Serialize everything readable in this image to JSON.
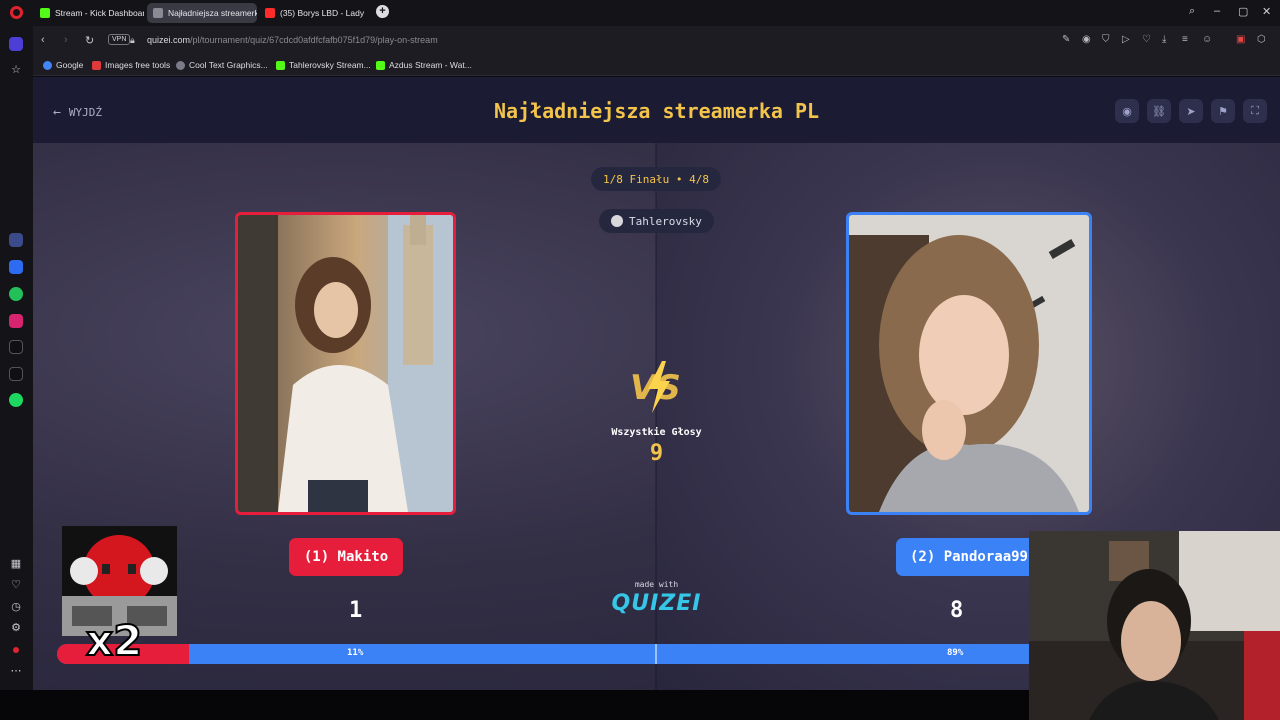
{
  "browser": {
    "tabs": [
      {
        "label": "Stream - Kick Dashboard",
        "color": "#53fc18"
      },
      {
        "label": "Najładniejsza streamerka",
        "color": "#8a8a94"
      },
      {
        "label": "(35) Borys LBD - Lady",
        "color": "#ff2b2b"
      }
    ],
    "new_tab": "+",
    "vpn": "VPN",
    "url_host": "quizei.com",
    "url_path": "/pl/tournament/quiz/67cdcd0afdfcfafb075f1d79/play-on-stream",
    "bookmarks": [
      {
        "label": "Google",
        "color": "#4285f4"
      },
      {
        "label": "Images free tools",
        "color": "#e03a3a"
      },
      {
        "label": "Cool Text Graphics...",
        "color": "#7a7a88"
      },
      {
        "label": "Tahlerovsky Stream...",
        "color": "#53fc18"
      },
      {
        "label": "Azdus Stream - Wat...",
        "color": "#53fc18"
      }
    ]
  },
  "quiz": {
    "exit_label": "WYJDŹ",
    "title": "Najładniejsza streamerka PL",
    "round": "1/8 Finału • 4/8",
    "user": "Tahlerovsky",
    "vs": "VS",
    "total_votes_label": "Wszystkie Głosy",
    "total_votes": "9",
    "left": {
      "name": "(1) Makito",
      "score": "1",
      "percent": "11%",
      "fraction": 0.11
    },
    "right": {
      "name": "(2) Pandoraa99",
      "score": "8",
      "percent": "89%",
      "fraction": 0.89
    },
    "made_with": "made with",
    "logo": "QUIZEI"
  },
  "overlay": {
    "multiplier": "x2"
  },
  "colors": {
    "accent": "#f3c44b",
    "left": "#e61e3c",
    "right": "#3b82f6",
    "bg": "#1c1c2e"
  }
}
